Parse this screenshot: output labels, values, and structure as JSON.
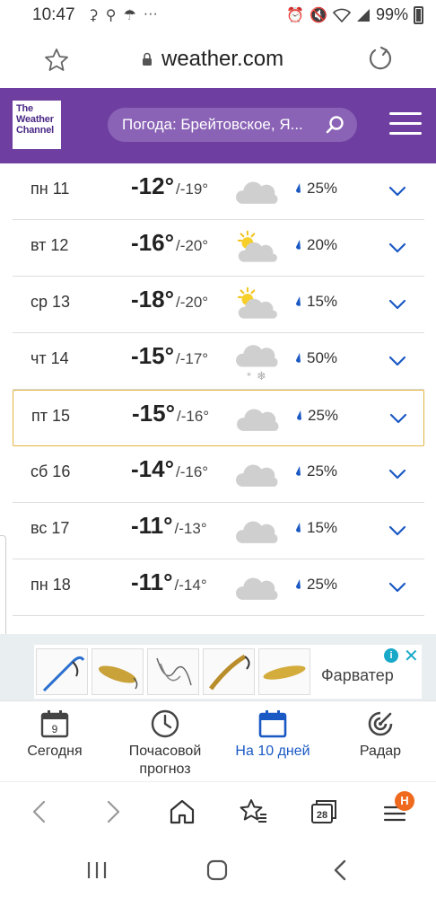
{
  "status_bar": {
    "time": "10:47",
    "battery": "99%"
  },
  "browser": {
    "url": "weather.com"
  },
  "site_header": {
    "logo_lines": [
      "The",
      "Weather",
      "Channel"
    ],
    "search_text": "Погода: Брейтовское, Я..."
  },
  "forecast": {
    "rows": [
      {
        "day": "пн 11",
        "high": "-12°",
        "low": "/-19°",
        "icon": "cloudy-icon",
        "precip": "25%"
      },
      {
        "day": "вт 12",
        "high": "-16°",
        "low": "/-20°",
        "icon": "partly-cloudy-icon",
        "precip": "20%"
      },
      {
        "day": "ср 13",
        "high": "-18°",
        "low": "/-20°",
        "icon": "partly-cloudy-icon",
        "precip": "15%"
      },
      {
        "day": "чт 14",
        "high": "-15°",
        "low": "/-17°",
        "icon": "snow-icon",
        "precip": "50%"
      },
      {
        "day": "пт 15",
        "high": "-15°",
        "low": "/-16°",
        "icon": "cloudy-icon",
        "precip": "25%",
        "selected": true
      },
      {
        "day": "сб 16",
        "high": "-14°",
        "low": "/-16°",
        "icon": "cloudy-icon",
        "precip": "25%"
      },
      {
        "day": "вс 17",
        "high": "-11°",
        "low": "/-13°",
        "icon": "cloudy-icon",
        "precip": "15%"
      },
      {
        "day": "пн 18",
        "high": "-11°",
        "low": "/-14°",
        "icon": "cloudy-icon",
        "precip": "25%"
      }
    ]
  },
  "ad": {
    "brand": "Фарватер"
  },
  "site_nav": {
    "today": {
      "label": "Сегодня",
      "date": "9"
    },
    "hourly": {
      "label_line1": "Почасовой",
      "label_line2": "прогноз"
    },
    "ten_day": {
      "label": "На 10 дней"
    },
    "radar": {
      "label": "Радар"
    }
  },
  "browser_toolbar": {
    "tabs_count": "28",
    "menu_badge": "Н"
  },
  "colors": {
    "header_purple": "#6e3fa0",
    "active_blue": "#1a58c4",
    "selected_border": "#e3b441",
    "badge_orange": "#ef6a1e"
  }
}
